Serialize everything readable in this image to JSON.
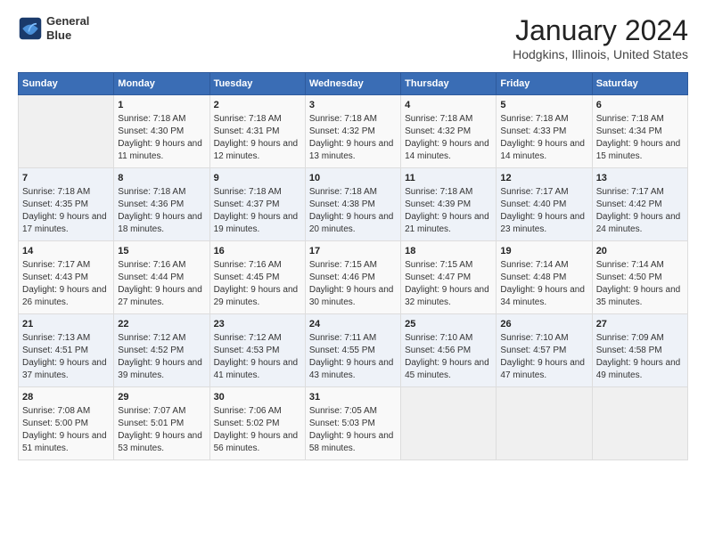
{
  "header": {
    "logo_line1": "General",
    "logo_line2": "Blue",
    "month": "January 2024",
    "location": "Hodgkins, Illinois, United States"
  },
  "weekdays": [
    "Sunday",
    "Monday",
    "Tuesday",
    "Wednesday",
    "Thursday",
    "Friday",
    "Saturday"
  ],
  "weeks": [
    [
      {
        "day": "",
        "sunrise": "",
        "sunset": "",
        "daylight": ""
      },
      {
        "day": "1",
        "sunrise": "Sunrise: 7:18 AM",
        "sunset": "Sunset: 4:30 PM",
        "daylight": "Daylight: 9 hours and 11 minutes."
      },
      {
        "day": "2",
        "sunrise": "Sunrise: 7:18 AM",
        "sunset": "Sunset: 4:31 PM",
        "daylight": "Daylight: 9 hours and 12 minutes."
      },
      {
        "day": "3",
        "sunrise": "Sunrise: 7:18 AM",
        "sunset": "Sunset: 4:32 PM",
        "daylight": "Daylight: 9 hours and 13 minutes."
      },
      {
        "day": "4",
        "sunrise": "Sunrise: 7:18 AM",
        "sunset": "Sunset: 4:32 PM",
        "daylight": "Daylight: 9 hours and 14 minutes."
      },
      {
        "day": "5",
        "sunrise": "Sunrise: 7:18 AM",
        "sunset": "Sunset: 4:33 PM",
        "daylight": "Daylight: 9 hours and 14 minutes."
      },
      {
        "day": "6",
        "sunrise": "Sunrise: 7:18 AM",
        "sunset": "Sunset: 4:34 PM",
        "daylight": "Daylight: 9 hours and 15 minutes."
      }
    ],
    [
      {
        "day": "7",
        "sunrise": "Sunrise: 7:18 AM",
        "sunset": "Sunset: 4:35 PM",
        "daylight": "Daylight: 9 hours and 17 minutes."
      },
      {
        "day": "8",
        "sunrise": "Sunrise: 7:18 AM",
        "sunset": "Sunset: 4:36 PM",
        "daylight": "Daylight: 9 hours and 18 minutes."
      },
      {
        "day": "9",
        "sunrise": "Sunrise: 7:18 AM",
        "sunset": "Sunset: 4:37 PM",
        "daylight": "Daylight: 9 hours and 19 minutes."
      },
      {
        "day": "10",
        "sunrise": "Sunrise: 7:18 AM",
        "sunset": "Sunset: 4:38 PM",
        "daylight": "Daylight: 9 hours and 20 minutes."
      },
      {
        "day": "11",
        "sunrise": "Sunrise: 7:18 AM",
        "sunset": "Sunset: 4:39 PM",
        "daylight": "Daylight: 9 hours and 21 minutes."
      },
      {
        "day": "12",
        "sunrise": "Sunrise: 7:17 AM",
        "sunset": "Sunset: 4:40 PM",
        "daylight": "Daylight: 9 hours and 23 minutes."
      },
      {
        "day": "13",
        "sunrise": "Sunrise: 7:17 AM",
        "sunset": "Sunset: 4:42 PM",
        "daylight": "Daylight: 9 hours and 24 minutes."
      }
    ],
    [
      {
        "day": "14",
        "sunrise": "Sunrise: 7:17 AM",
        "sunset": "Sunset: 4:43 PM",
        "daylight": "Daylight: 9 hours and 26 minutes."
      },
      {
        "day": "15",
        "sunrise": "Sunrise: 7:16 AM",
        "sunset": "Sunset: 4:44 PM",
        "daylight": "Daylight: 9 hours and 27 minutes."
      },
      {
        "day": "16",
        "sunrise": "Sunrise: 7:16 AM",
        "sunset": "Sunset: 4:45 PM",
        "daylight": "Daylight: 9 hours and 29 minutes."
      },
      {
        "day": "17",
        "sunrise": "Sunrise: 7:15 AM",
        "sunset": "Sunset: 4:46 PM",
        "daylight": "Daylight: 9 hours and 30 minutes."
      },
      {
        "day": "18",
        "sunrise": "Sunrise: 7:15 AM",
        "sunset": "Sunset: 4:47 PM",
        "daylight": "Daylight: 9 hours and 32 minutes."
      },
      {
        "day": "19",
        "sunrise": "Sunrise: 7:14 AM",
        "sunset": "Sunset: 4:48 PM",
        "daylight": "Daylight: 9 hours and 34 minutes."
      },
      {
        "day": "20",
        "sunrise": "Sunrise: 7:14 AM",
        "sunset": "Sunset: 4:50 PM",
        "daylight": "Daylight: 9 hours and 35 minutes."
      }
    ],
    [
      {
        "day": "21",
        "sunrise": "Sunrise: 7:13 AM",
        "sunset": "Sunset: 4:51 PM",
        "daylight": "Daylight: 9 hours and 37 minutes."
      },
      {
        "day": "22",
        "sunrise": "Sunrise: 7:12 AM",
        "sunset": "Sunset: 4:52 PM",
        "daylight": "Daylight: 9 hours and 39 minutes."
      },
      {
        "day": "23",
        "sunrise": "Sunrise: 7:12 AM",
        "sunset": "Sunset: 4:53 PM",
        "daylight": "Daylight: 9 hours and 41 minutes."
      },
      {
        "day": "24",
        "sunrise": "Sunrise: 7:11 AM",
        "sunset": "Sunset: 4:55 PM",
        "daylight": "Daylight: 9 hours and 43 minutes."
      },
      {
        "day": "25",
        "sunrise": "Sunrise: 7:10 AM",
        "sunset": "Sunset: 4:56 PM",
        "daylight": "Daylight: 9 hours and 45 minutes."
      },
      {
        "day": "26",
        "sunrise": "Sunrise: 7:10 AM",
        "sunset": "Sunset: 4:57 PM",
        "daylight": "Daylight: 9 hours and 47 minutes."
      },
      {
        "day": "27",
        "sunrise": "Sunrise: 7:09 AM",
        "sunset": "Sunset: 4:58 PM",
        "daylight": "Daylight: 9 hours and 49 minutes."
      }
    ],
    [
      {
        "day": "28",
        "sunrise": "Sunrise: 7:08 AM",
        "sunset": "Sunset: 5:00 PM",
        "daylight": "Daylight: 9 hours and 51 minutes."
      },
      {
        "day": "29",
        "sunrise": "Sunrise: 7:07 AM",
        "sunset": "Sunset: 5:01 PM",
        "daylight": "Daylight: 9 hours and 53 minutes."
      },
      {
        "day": "30",
        "sunrise": "Sunrise: 7:06 AM",
        "sunset": "Sunset: 5:02 PM",
        "daylight": "Daylight: 9 hours and 56 minutes."
      },
      {
        "day": "31",
        "sunrise": "Sunrise: 7:05 AM",
        "sunset": "Sunset: 5:03 PM",
        "daylight": "Daylight: 9 hours and 58 minutes."
      },
      {
        "day": "",
        "sunrise": "",
        "sunset": "",
        "daylight": ""
      },
      {
        "day": "",
        "sunrise": "",
        "sunset": "",
        "daylight": ""
      },
      {
        "day": "",
        "sunrise": "",
        "sunset": "",
        "daylight": ""
      }
    ]
  ]
}
